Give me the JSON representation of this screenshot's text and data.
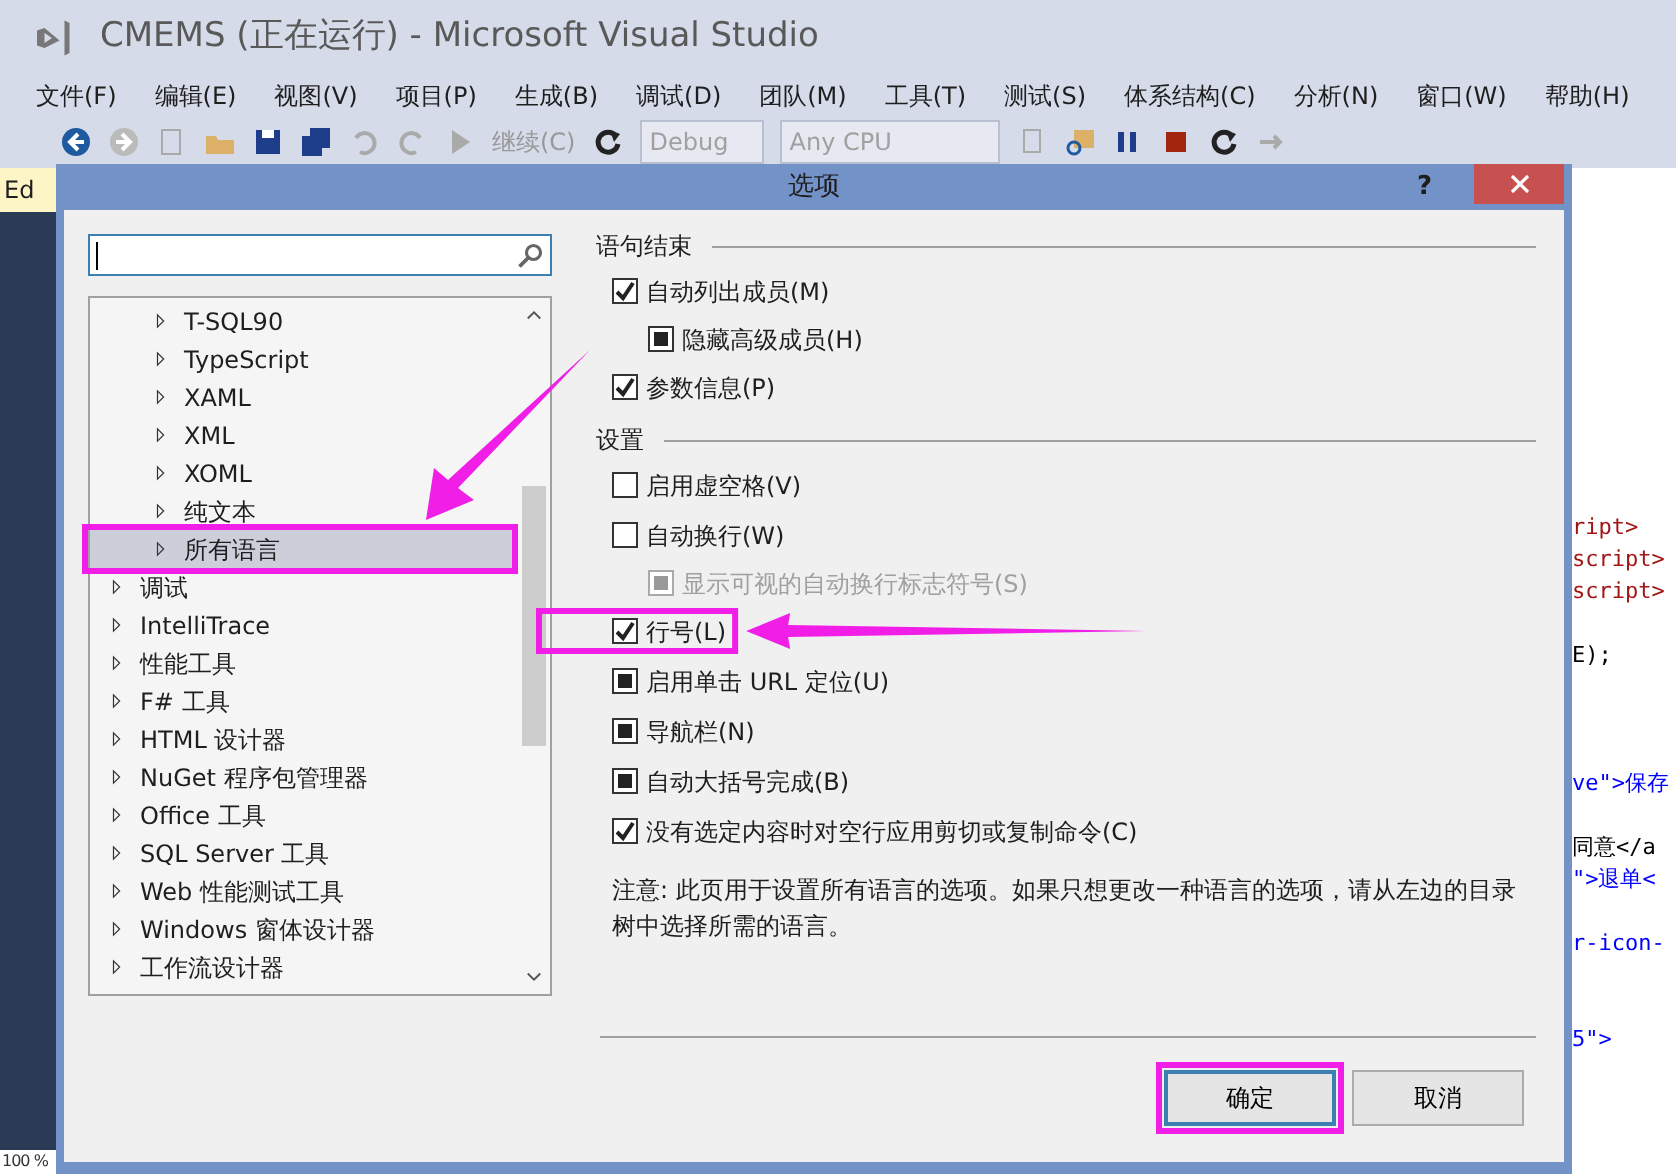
{
  "window": {
    "title": "CMEMS (正在运行) - Microsoft Visual Studio"
  },
  "menu": [
    "文件(F)",
    "编辑(E)",
    "视图(V)",
    "项目(P)",
    "生成(B)",
    "调试(D)",
    "团队(M)",
    "工具(T)",
    "测试(S)",
    "体系结构(C)",
    "分析(N)",
    "窗口(W)",
    "帮助(H)"
  ],
  "toolbar": {
    "continue_label": "继续(C)",
    "configuration": "Debug",
    "platform": "Any CPU"
  },
  "editor": {
    "tab": "Ed",
    "zoom": "100 %",
    "code_lines": [
      {
        "text": "ript>",
        "kind": "tag"
      },
      {
        "text": "script>",
        "kind": "tag"
      },
      {
        "text": "script>",
        "kind": "tag"
      },
      {
        "kind": "gap"
      },
      {
        "text": "E);",
        "kind": "plain"
      },
      {
        "kind": "gap"
      },
      {
        "kind": "gap"
      },
      {
        "kind": "gap"
      },
      {
        "text": "ve\">保存",
        "kind": "attr"
      },
      {
        "kind": "gap"
      },
      {
        "text": "同意</a",
        "kind": "plain"
      },
      {
        "text": "\">退单<",
        "kind": "attr"
      },
      {
        "kind": "gap"
      },
      {
        "text": "r-icon-",
        "kind": "attr"
      },
      {
        "kind": "gap"
      },
      {
        "kind": "gap"
      },
      {
        "text": "5\">",
        "kind": "attr"
      }
    ]
  },
  "dialog": {
    "title": "选项",
    "help": "?",
    "tree": {
      "sub_items": [
        {
          "label": "T-SQL90",
          "selected": false
        },
        {
          "label": "TypeScript",
          "selected": false
        },
        {
          "label": "XAML",
          "selected": false
        },
        {
          "label": "XML",
          "selected": false
        },
        {
          "label": "XOML",
          "selected": false
        },
        {
          "label": "纯文本",
          "selected": false
        },
        {
          "label": "所有语言",
          "selected": true
        }
      ],
      "items": [
        {
          "label": "调试",
          "selected": false
        },
        {
          "label": "IntelliTrace",
          "selected": false
        },
        {
          "label": "性能工具",
          "selected": false
        },
        {
          "label": "F# 工具",
          "selected": false
        },
        {
          "label": "HTML 设计器",
          "selected": false
        },
        {
          "label": "NuGet 程序包管理器",
          "selected": false
        },
        {
          "label": "Office 工具",
          "selected": false
        },
        {
          "label": "SQL Server 工具",
          "selected": false
        },
        {
          "label": "Web 性能测试工具",
          "selected": false
        },
        {
          "label": "Windows 窗体设计器",
          "selected": false
        },
        {
          "label": "工作流设计器",
          "selected": false
        }
      ]
    },
    "groups": [
      {
        "title": "语句结束",
        "options": [
          {
            "label": "自动列出成员(M)",
            "checked": true,
            "indeterminate": false,
            "disabled": false,
            "children": [
              {
                "label": "隐藏高级成员(H)",
                "checked": false,
                "indeterminate": true,
                "disabled": false
              }
            ]
          },
          {
            "label": "参数信息(P)",
            "checked": true,
            "indeterminate": false,
            "disabled": false
          }
        ]
      },
      {
        "title": "设置",
        "options": [
          {
            "label": "启用虚空格(V)",
            "checked": false,
            "indeterminate": false,
            "disabled": false
          },
          {
            "label": "自动换行(W)",
            "checked": false,
            "indeterminate": false,
            "disabled": false,
            "children": [
              {
                "label": "显示可视的自动换行标志符号(S)",
                "checked": false,
                "indeterminate": true,
                "disabled": true
              }
            ]
          },
          {
            "label": "行号(L)",
            "checked": true,
            "indeterminate": false,
            "disabled": false
          },
          {
            "label": "启用单击 URL 定位(U)",
            "checked": false,
            "indeterminate": true,
            "disabled": false
          },
          {
            "label": "导航栏(N)",
            "checked": false,
            "indeterminate": true,
            "disabled": false
          },
          {
            "label": "自动大括号完成(B)",
            "checked": false,
            "indeterminate": true,
            "disabled": false
          },
          {
            "label": "没有选定内容时对空行应用剪切或复制命令(C)",
            "checked": true,
            "indeterminate": false,
            "disabled": false
          }
        ]
      }
    ],
    "note": "注意: 此页用于设置所有语言的选项。如果只想更改一种语言的选项，请从左边的目录树中选择所需的语言。",
    "buttons": [
      {
        "label": "确定",
        "default": true
      },
      {
        "label": "取消",
        "default": false
      }
    ]
  }
}
